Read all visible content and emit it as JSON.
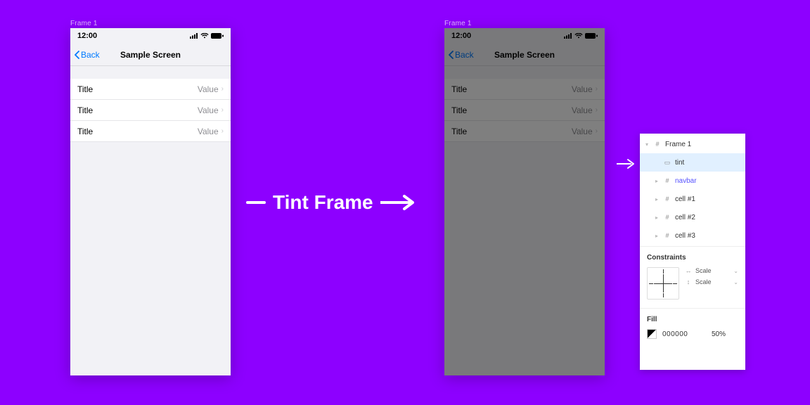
{
  "frame_labels": {
    "left": "Frame 1",
    "right": "Frame 1"
  },
  "statusbar": {
    "time": "12:00"
  },
  "nav": {
    "back": "Back",
    "title": "Sample Screen"
  },
  "cells": [
    {
      "title": "Title",
      "value": "Value"
    },
    {
      "title": "Title",
      "value": "Value"
    },
    {
      "title": "Title",
      "value": "Value"
    }
  ],
  "center_label": "Tint Frame",
  "panel": {
    "layers": {
      "root": "Frame 1",
      "tint": "tint",
      "navbar": "navbar",
      "cell1": "cell #1",
      "cell2": "cell #2",
      "cell3": "cell #3"
    },
    "constraints": {
      "heading": "Constraints",
      "h": "Scale",
      "v": "Scale"
    },
    "fill": {
      "heading": "Fill",
      "hex": "000000",
      "opacity": "50%"
    }
  }
}
